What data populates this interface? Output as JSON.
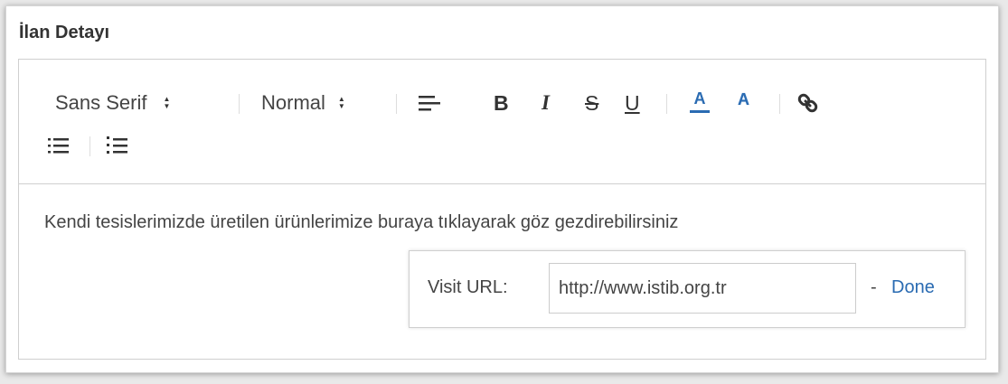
{
  "card": {
    "title": "İlan Detayı"
  },
  "toolbar": {
    "font_picker": "Sans Serif",
    "size_picker": "Normal",
    "picker_arrow_up": "▲",
    "picker_arrow_down": "▼",
    "bold": "B",
    "italic": "I",
    "strike": "S",
    "underline": "U",
    "text_color": "A",
    "background_color": "A",
    "icons": [
      "align-left-icon",
      "link-icon",
      "bullet-list-icon",
      "ordered-list-icon"
    ],
    "accent_color": "#2a6bb2"
  },
  "editor": {
    "text": "Kendi tesislerimizde üretilen ürünlerimize buraya tıklayarak göz gezdirebilirsiniz"
  },
  "link_tooltip": {
    "label": "Visit URL:",
    "url_value": "http://www.istib.org.tr",
    "dash": "-",
    "done_label": "Done"
  }
}
